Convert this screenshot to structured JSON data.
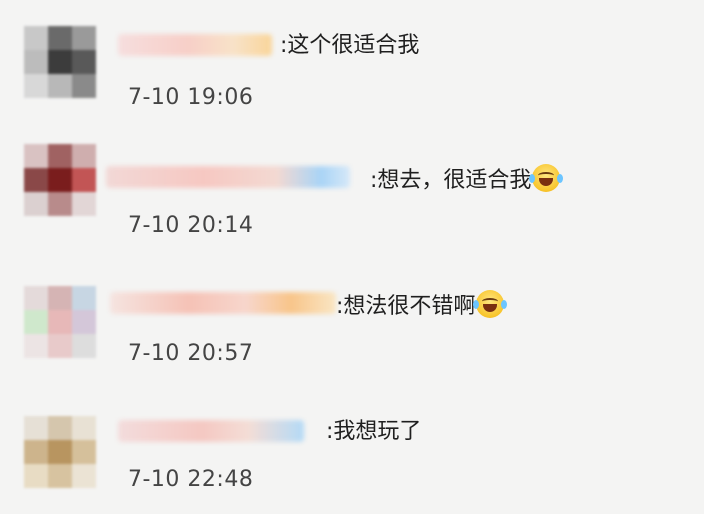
{
  "comments": [
    {
      "text": ":这个很适合我",
      "time": "7-10 19:06",
      "emoji": ""
    },
    {
      "text": ":想去，很适合我",
      "time": "7-10 20:14",
      "emoji": "laughing-crying-emoji-icon"
    },
    {
      "text": ":想法很不错啊",
      "time": "7-10 20:57",
      "emoji": "laughing-crying-emoji-icon"
    },
    {
      "text": ":我想玩了",
      "time": "7-10 22:48",
      "emoji": ""
    }
  ]
}
